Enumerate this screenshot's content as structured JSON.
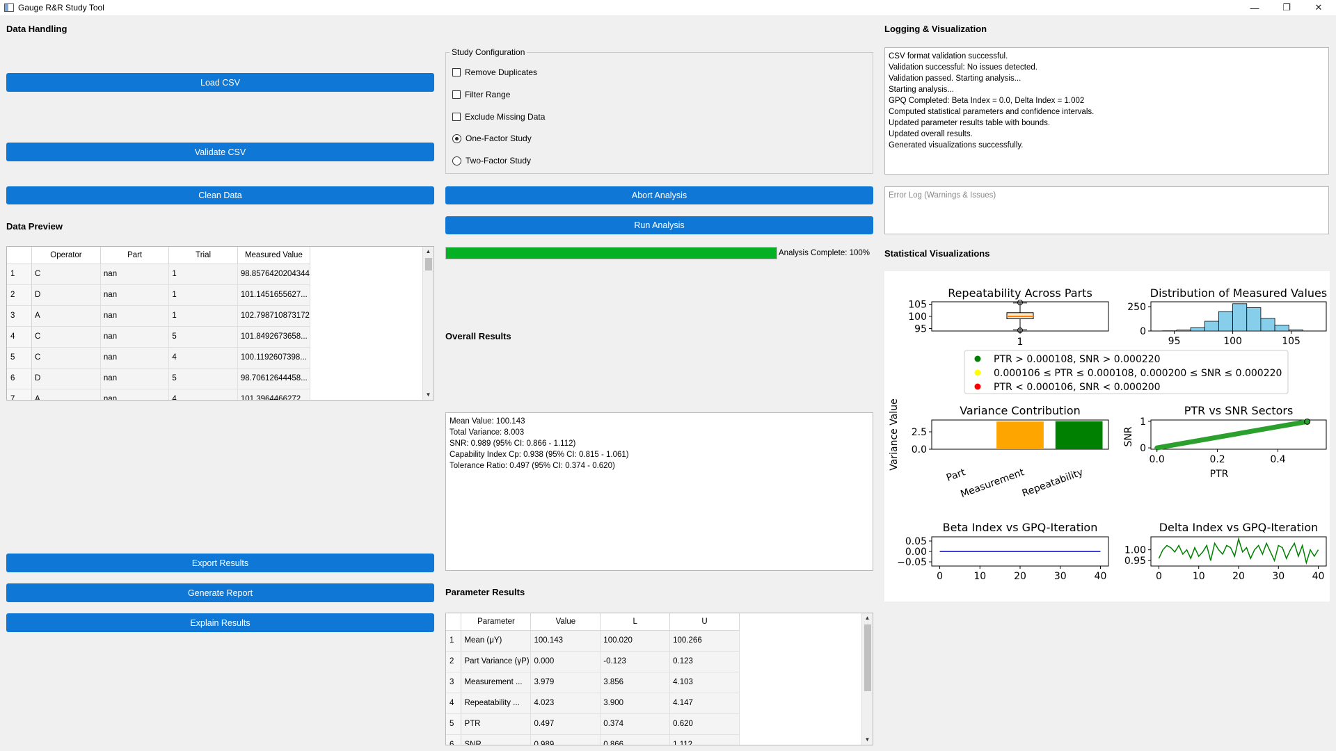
{
  "window": {
    "title": "Gauge R&R Study Tool",
    "min_glyph": "—",
    "max_glyph": "❐",
    "close_glyph": "✕"
  },
  "data_handling": {
    "title": "Data Handling",
    "load_csv": "Load CSV",
    "validate_csv": "Validate CSV",
    "clean_data": "Clean Data",
    "preview_title": "Data Preview",
    "export_results": "Export Results",
    "generate_report": "Generate Report",
    "explain_results": "Explain Results"
  },
  "preview_table": {
    "headers": [
      "Operator",
      "Part",
      "Trial",
      "Measured Value"
    ],
    "rows": [
      {
        "n": "1",
        "c": [
          "C",
          "nan",
          "1",
          "98.8576420204344"
        ]
      },
      {
        "n": "2",
        "c": [
          "D",
          "nan",
          "1",
          "101.1451655627..."
        ]
      },
      {
        "n": "3",
        "c": [
          "A",
          "nan",
          "1",
          "102.798710873172"
        ]
      },
      {
        "n": "4",
        "c": [
          "C",
          "nan",
          "5",
          "101.8492673658..."
        ]
      },
      {
        "n": "5",
        "c": [
          "C",
          "nan",
          "4",
          "100.1192607398..."
        ]
      },
      {
        "n": "6",
        "c": [
          "D",
          "nan",
          "5",
          "98.70612644458..."
        ]
      },
      {
        "n": "7",
        "c": [
          "A",
          "nan",
          "4",
          "101.3964466272"
        ]
      }
    ]
  },
  "study_config": {
    "title": "Study Configuration",
    "remove_duplicates": "Remove Duplicates",
    "filter_range": "Filter Range",
    "exclude_missing": "Exclude Missing Data",
    "one_factor": "One-Factor Study",
    "two_factor": "Two-Factor Study",
    "selected": "One-Factor Study"
  },
  "analysis": {
    "abort": "Abort Analysis",
    "run": "Run Analysis",
    "progress_value": 100,
    "progress_label": "Analysis Complete: 100%"
  },
  "overall": {
    "title": "Overall Results",
    "lines": [
      "Mean Value: 100.143",
      "Total Variance: 8.003",
      "SNR: 0.989 (95% CI: 0.866 - 1.112)",
      "Capability Index Cp: 0.938 (95% CI: 0.815 - 1.061)",
      "Tolerance Ratio: 0.497 (95% CI: 0.374 - 0.620)"
    ]
  },
  "param_results": {
    "title": "Parameter Results",
    "headers": [
      "Parameter",
      "Value",
      "L",
      "U"
    ],
    "rows": [
      {
        "n": "1",
        "c": [
          "Mean (μY)",
          "100.143",
          "100.020",
          "100.266"
        ]
      },
      {
        "n": "2",
        "c": [
          "Part Variance (γP)",
          "0.000",
          "-0.123",
          "0.123"
        ]
      },
      {
        "n": "3",
        "c": [
          "Measurement ...",
          "3.979",
          "3.856",
          "4.103"
        ]
      },
      {
        "n": "4",
        "c": [
          "Repeatability ...",
          "4.023",
          "3.900",
          "4.147"
        ]
      },
      {
        "n": "5",
        "c": [
          "PTR",
          "0.497",
          "0.374",
          "0.620"
        ]
      },
      {
        "n": "6",
        "c": [
          "SNR",
          "0.989",
          "0.866",
          "1.112"
        ]
      }
    ]
  },
  "logging": {
    "title": "Logging & Visualization",
    "log_lines": [
      "CSV format validation successful.",
      "Validation successful: No issues detected.",
      "Validation passed. Starting analysis...",
      "Starting analysis...",
      "GPQ Completed: Beta Index = 0.0, Delta Index = 1.002",
      "Computed statistical parameters and confidence intervals.",
      "Updated parameter results table with bounds.",
      "Updated overall results.",
      "Generated visualizations successfully."
    ],
    "error_placeholder": "Error Log (Warnings & Issues)",
    "viz_title": "Statistical Visualizations"
  },
  "chart_data": [
    {
      "type": "boxplot",
      "title": "Repeatability Across Parts",
      "categories": [
        "1"
      ],
      "yticks": [
        "95",
        "100",
        "105"
      ],
      "ylim": [
        94,
        106
      ],
      "box": {
        "q1": 99,
        "median": 100,
        "q3": 101.5,
        "whisker_low": 94.5,
        "whisker_high": 105.5
      }
    },
    {
      "type": "bar",
      "title": "Distribution of Measured Values",
      "xticks": [
        "95",
        "100",
        "105"
      ],
      "yticks": [
        "0",
        "250"
      ],
      "xlim": [
        93,
        108
      ],
      "ylim": [
        0,
        300
      ],
      "bin_edges": [
        94,
        95.2,
        96.4,
        97.6,
        98.8,
        100,
        101.2,
        102.4,
        103.6,
        104.8,
        106
      ],
      "values": [
        2,
        10,
        35,
        100,
        200,
        280,
        240,
        130,
        60,
        12
      ]
    },
    {
      "type": "legend",
      "entries": [
        {
          "label": "PTR > 0.000108, SNR > 0.000220",
          "color": "#008000"
        },
        {
          "label": "0.000106 ≤ PTR ≤ 0.000108, 0.000200 ≤ SNR ≤ 0.000220",
          "color": "#ffff00"
        },
        {
          "label": "PTR < 0.000106, SNR < 0.000200",
          "color": "#ff0000"
        }
      ]
    },
    {
      "type": "bar",
      "title": "Variance Contribution",
      "ylabel": "Variance Value",
      "categories": [
        "Part",
        "Measurement",
        "Repeatability"
      ],
      "values": [
        0.0,
        3.979,
        4.023
      ],
      "colors": [
        "#ffffff",
        "#ffa500",
        "#008000"
      ],
      "yticks": [
        "0.0",
        "2.5"
      ],
      "ylim": [
        0,
        4.2
      ]
    },
    {
      "type": "scatter",
      "title": "PTR vs SNR Sectors",
      "xlabel": "PTR",
      "ylabel": "SNR",
      "xticks": [
        "0.0",
        "0.2",
        "0.4"
      ],
      "yticks": [
        "0",
        "1"
      ],
      "xlim": [
        -0.02,
        0.56
      ],
      "ylim": [
        -0.05,
        1.05
      ],
      "series": [
        {
          "x": [
            0.0,
            0.1,
            0.2,
            0.3,
            0.4,
            0.497
          ],
          "y": [
            0.0,
            0.2,
            0.4,
            0.6,
            0.8,
            0.989
          ],
          "color": "#2ca02c"
        }
      ],
      "highlight": {
        "x": 0.497,
        "y": 0.989
      }
    },
    {
      "type": "line",
      "title": "Beta Index vs GPQ-Iteration",
      "xticks": [
        "0",
        "10",
        "20",
        "30",
        "40"
      ],
      "yticks": [
        "0.05",
        "0.00",
        "−0.05"
      ],
      "xlim": [
        -2,
        42
      ],
      "ylim": [
        -0.07,
        0.07
      ],
      "x": [
        0,
        40
      ],
      "y": [
        0.0,
        0.0
      ],
      "color": "#0000cc"
    },
    {
      "type": "line",
      "title": "Delta Index vs GPQ-Iteration",
      "xticks": [
        "0",
        "10",
        "20",
        "30",
        "40"
      ],
      "yticks": [
        "1.00",
        "0.95"
      ],
      "xlim": [
        -2,
        42
      ],
      "ylim": [
        0.925,
        1.06
      ],
      "x": [
        0,
        1,
        2,
        3,
        4,
        5,
        6,
        7,
        8,
        9,
        10,
        11,
        12,
        13,
        14,
        15,
        16,
        17,
        18,
        19,
        20,
        21,
        22,
        23,
        24,
        25,
        26,
        27,
        28,
        29,
        30,
        31,
        32,
        33,
        34,
        35,
        36,
        37,
        38,
        39,
        40
      ],
      "y": [
        0.96,
        1.0,
        1.02,
        1.01,
        0.99,
        1.02,
        0.98,
        1.0,
        0.96,
        1.01,
        0.97,
        0.99,
        1.02,
        0.95,
        1.03,
        1.0,
        0.98,
        1.02,
        1.01,
        0.97,
        1.05,
        0.99,
        1.01,
        0.96,
        1.0,
        1.02,
        0.98,
        1.03,
        0.99,
        0.95,
        1.02,
        1.01,
        0.96,
        1.0,
        1.03,
        0.97,
        1.02,
        0.94,
        1.0,
        0.97,
        1.0
      ],
      "color": "#008000"
    }
  ]
}
